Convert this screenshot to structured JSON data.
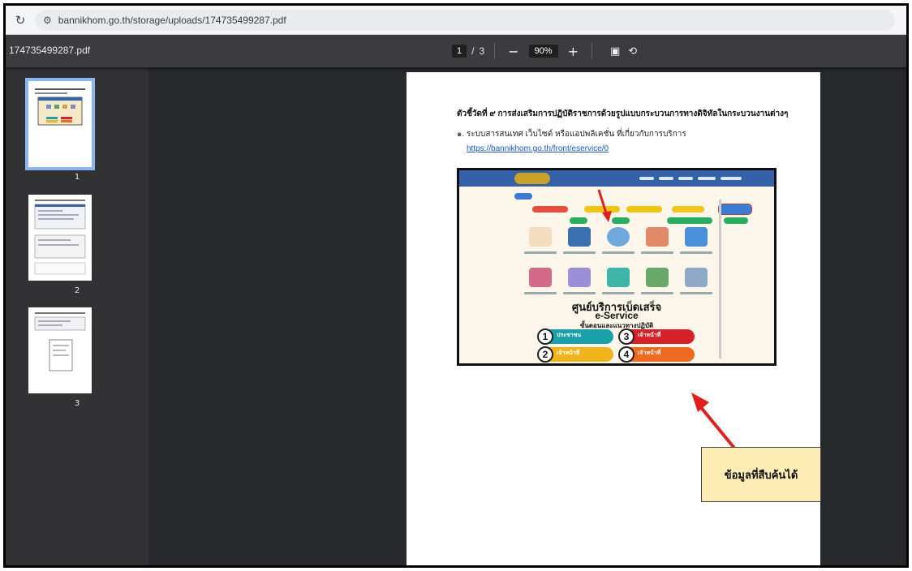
{
  "browser": {
    "url": "bannikhom.go.th/storage/uploads/174735499287.pdf"
  },
  "pdf": {
    "filename": "174735499287.pdf",
    "current_page": "1",
    "page_sep": "/",
    "total_pages": "3",
    "zoom": "90%",
    "zoom_out": "−",
    "zoom_in": "+"
  },
  "thumbnails": [
    {
      "label": "1"
    },
    {
      "label": "2"
    },
    {
      "label": "3"
    }
  ],
  "page": {
    "heading": "ตัวชี้วัดที่ ๙ การส่งเสริมการปฏิบัติราชการด้วยรูปแบบกระบวนการทางดิจิทัลในกระบวนงานต่างๆ",
    "item": "๑. ระบบสารสนเทศ เว็บไซต์ หรือแอปพลิเคชั่น ที่เกี่ยวกับการบริการ",
    "link": "https://bannikhom.go.th/front/eservice/0"
  },
  "embedded": {
    "title_th": "ศูนย์บริการเบ็ดเสร็จ",
    "title_en": "e-Service",
    "subtitle": "ขั้นตอนและแนวทางปฏิบัติ",
    "steps": [
      {
        "num": "1",
        "label": "ประชาชน",
        "color": "#1aa0a8"
      },
      {
        "num": "3",
        "label": "เจ้าหน้าที่",
        "color": "#d6202a"
      },
      {
        "num": "2",
        "label": "เจ้าหน้าที่",
        "color": "#f1b51c"
      },
      {
        "num": "4",
        "label": "เจ้าหน้าที่",
        "color": "#ef6a1f"
      }
    ]
  },
  "callout": {
    "text": "ข้อมูลที่สืบค้นได้"
  },
  "colors": {
    "toolbar": "#3c3c3f",
    "sidebar": "#323235",
    "viewer": "#27282b",
    "selected": "#8ab4f8",
    "arrow": "#e0201b",
    "callout_bg": "#fdecb4"
  }
}
